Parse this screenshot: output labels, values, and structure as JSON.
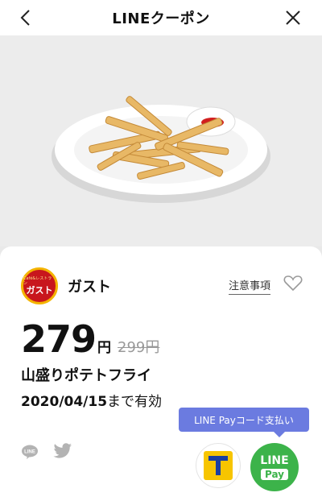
{
  "header": {
    "title": "LINEクーポン",
    "back_icon": "chevron-left-icon",
    "close_icon": "close-icon"
  },
  "hero": {
    "image": "french-fries-plate"
  },
  "brand": {
    "logo_top": "Café&レストラン",
    "logo_main": "ガスト",
    "name": "ガスト"
  },
  "actions": {
    "notes_label": "注意事項",
    "favorite_icon": "heart-icon"
  },
  "price": {
    "current": "279",
    "unit": "円",
    "original": "299円"
  },
  "product": {
    "name": "山盛りポテトフライ"
  },
  "expiry": {
    "date": "2020/04/15",
    "suffix": "まで有効"
  },
  "share": {
    "line_icon": "line-share-icon",
    "twitter_icon": "twitter-icon",
    "line_icon_text": "LINE"
  },
  "payment": {
    "tooltip": "LINE Payコード支払い",
    "tpoint_icon": "t-point-icon",
    "linepay_line1": "LINE",
    "linepay_line2": "Pay"
  },
  "colors": {
    "linepay_green": "#3cb34a",
    "tooltip_blue": "#6b7be0",
    "gusto_red": "#c8161d"
  }
}
